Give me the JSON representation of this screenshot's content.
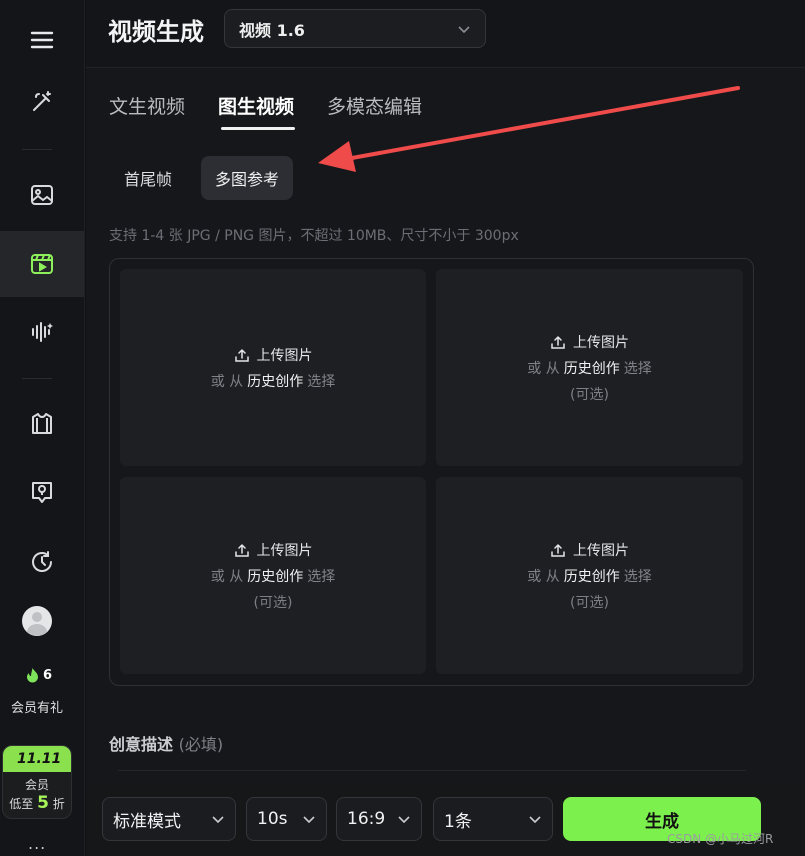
{
  "page": {
    "title": "视频生成"
  },
  "model": {
    "selected": "视频 1.6"
  },
  "tabs": [
    {
      "label": "文生视频"
    },
    {
      "label": "图生视频",
      "active": true
    },
    {
      "label": "多模态编辑"
    }
  ],
  "subtabs": [
    {
      "label": "首尾帧"
    },
    {
      "label": "多图参考",
      "active": true
    }
  ],
  "hint": "支持 1-4 张 JPG / PNG 图片，不超过 10MB、尺寸不小于 300px",
  "upload": {
    "title": "上传图片",
    "or_prefix": "或 从",
    "history": "历史创作",
    "select": "选择",
    "optional": "(可选)"
  },
  "sidebar": {
    "items": [
      {
        "icon": "magic-wand-icon"
      },
      {
        "icon": "image-icon"
      },
      {
        "icon": "video-icon",
        "active": true
      },
      {
        "icon": "audio-wave-icon"
      },
      {
        "icon": "shirt-icon"
      },
      {
        "icon": "lightbulb-badge-icon"
      },
      {
        "icon": "history-clock-icon"
      }
    ],
    "points": "6",
    "perk": "会员有礼",
    "promo": {
      "badge": "11.11",
      "line1": "会员",
      "line2_prefix": "低至",
      "number": "5",
      "line2_suffix": "折"
    },
    "more": "..."
  },
  "description": {
    "label": "创意描述",
    "note": "(必填)"
  },
  "footer": {
    "mode": "标准模式",
    "duration": "10s",
    "ratio": "16:9",
    "count": "1条",
    "generate": "生成"
  },
  "watermark": "CSDN @小马过河R",
  "colors": {
    "accent": "#7cf04d",
    "arrow": "#ef4b4b",
    "background": "#16171a"
  }
}
